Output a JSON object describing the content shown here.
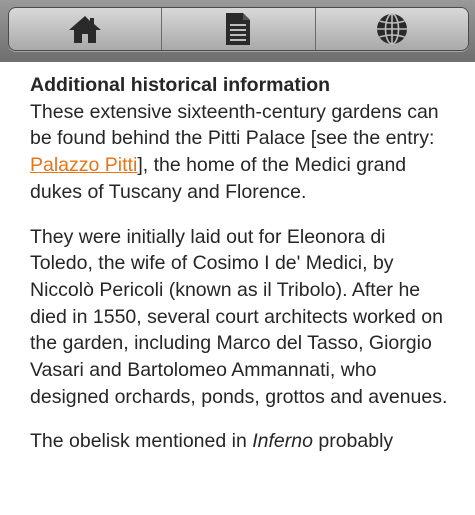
{
  "toolbar": {
    "buttons": [
      {
        "icon": "home-icon"
      },
      {
        "icon": "document-icon"
      },
      {
        "icon": "globe-icon"
      }
    ]
  },
  "article": {
    "heading": "Additional historical information",
    "p1_text_before": "These extensive sixteenth-century gardens can be found behind the Pitti Palace [see the entry: ",
    "p1_link": "Palazzo Pitti",
    "p1_text_after": "], the home of the Medici grand dukes of Tuscany and Florence.",
    "p2": "They were initially laid out for Eleonora di Toledo, the wife of Cosimo I de' Medici, by Niccolò Pericoli (known as il Tribolo). After he died in 1550, several court architects worked on the garden, including Marco del Tasso, Giorgio Vasari and Bartolomeo Ammannati, who designed orchards, ponds, grottos and avenues.",
    "p3_text_before": "The obelisk mentioned in ",
    "p3_em": "Inferno",
    "p3_text_after": " probably"
  },
  "colors": {
    "link": "#e8751a",
    "text": "#262626",
    "toolbar": "#808080"
  }
}
